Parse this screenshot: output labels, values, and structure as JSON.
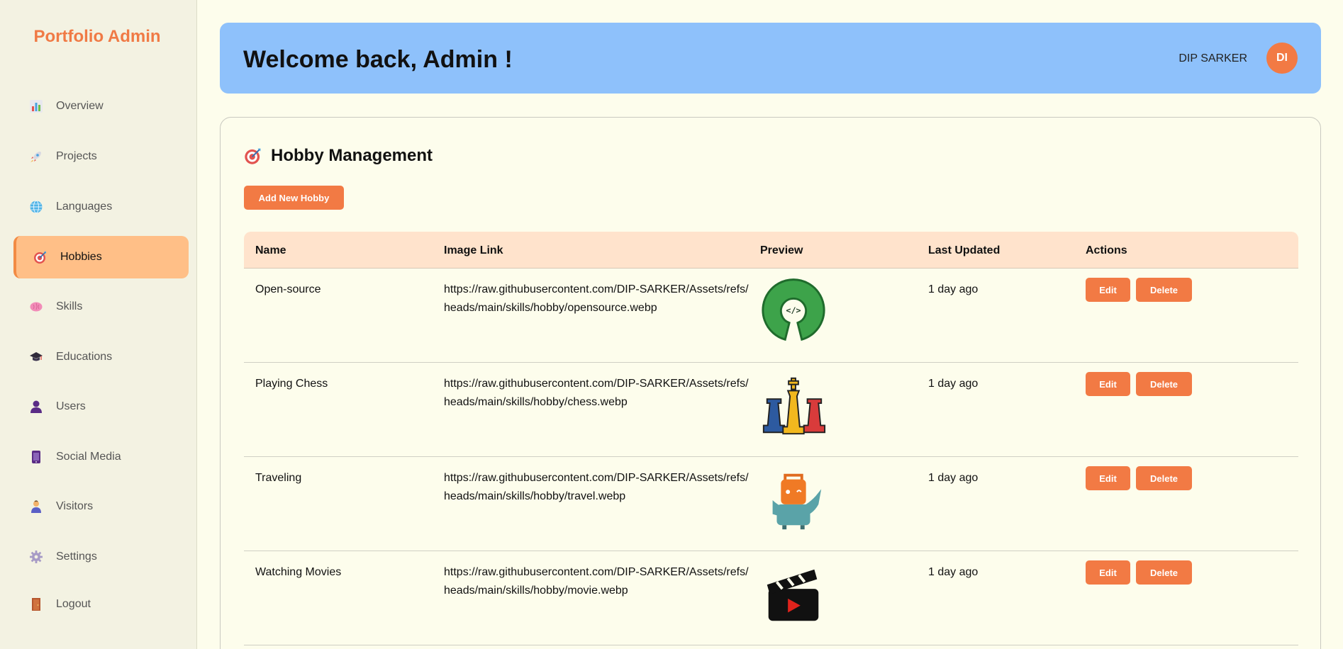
{
  "sidebar": {
    "brand": "Portfolio Admin",
    "items": [
      {
        "label": "Overview",
        "icon": "bar-chart-icon"
      },
      {
        "label": "Projects",
        "icon": "rocket-icon"
      },
      {
        "label": "Languages",
        "icon": "globe-icon"
      },
      {
        "label": "Hobbies",
        "icon": "target-icon",
        "active": true
      },
      {
        "label": "Skills",
        "icon": "brain-icon"
      },
      {
        "label": "Educations",
        "icon": "graduation-cap-icon"
      },
      {
        "label": "Users",
        "icon": "user-icon"
      },
      {
        "label": "Social Media",
        "icon": "phone-icon"
      },
      {
        "label": "Visitors",
        "icon": "person-icon"
      },
      {
        "label": "Settings",
        "icon": "gear-icon"
      },
      {
        "label": "Logout",
        "icon": "door-icon"
      }
    ]
  },
  "header": {
    "welcome": "Welcome back, Admin !",
    "user_name": "DIP SARKER",
    "avatar_initials": "DI"
  },
  "main": {
    "title": "Hobby Management",
    "title_icon": "target-icon",
    "add_button": "Add New Hobby",
    "columns": [
      "Name",
      "Image Link",
      "Preview",
      "Last Updated",
      "Actions"
    ],
    "rows": [
      {
        "name": "Open-source",
        "link": "https://raw.githubusercontent.com/DIP-SARKER/Assets/refs/heads/main/skills/hobby/opensource.webp",
        "preview_icon": "open-source-icon",
        "updated": "1 day ago",
        "edit": "Edit",
        "delete": "Delete"
      },
      {
        "name": "Playing Chess",
        "link": "https://raw.githubusercontent.com/DIP-SARKER/Assets/refs/heads/main/skills/hobby/chess.webp",
        "preview_icon": "chess-pieces-icon",
        "updated": "1 day ago",
        "edit": "Edit",
        "delete": "Delete"
      },
      {
        "name": "Traveling",
        "link": "https://raw.githubusercontent.com/DIP-SARKER/Assets/refs/heads/main/skills/hobby/travel.webp",
        "preview_icon": "suitcase-icon",
        "updated": "1 day ago",
        "edit": "Edit",
        "delete": "Delete"
      },
      {
        "name": "Watching Movies",
        "link": "https://raw.githubusercontent.com/DIP-SARKER/Assets/refs/heads/main/skills/hobby/movie.webp",
        "preview_icon": "clapperboard-icon",
        "updated": "1 day ago",
        "edit": "Edit",
        "delete": "Delete"
      }
    ]
  },
  "colors": {
    "accent": "#f27a44",
    "brand": "#f07a45",
    "header_bg": "#8ec1fb",
    "active_nav": "#ffbf87",
    "table_head": "#ffe3cc",
    "page_bg": "#fdfdec"
  }
}
